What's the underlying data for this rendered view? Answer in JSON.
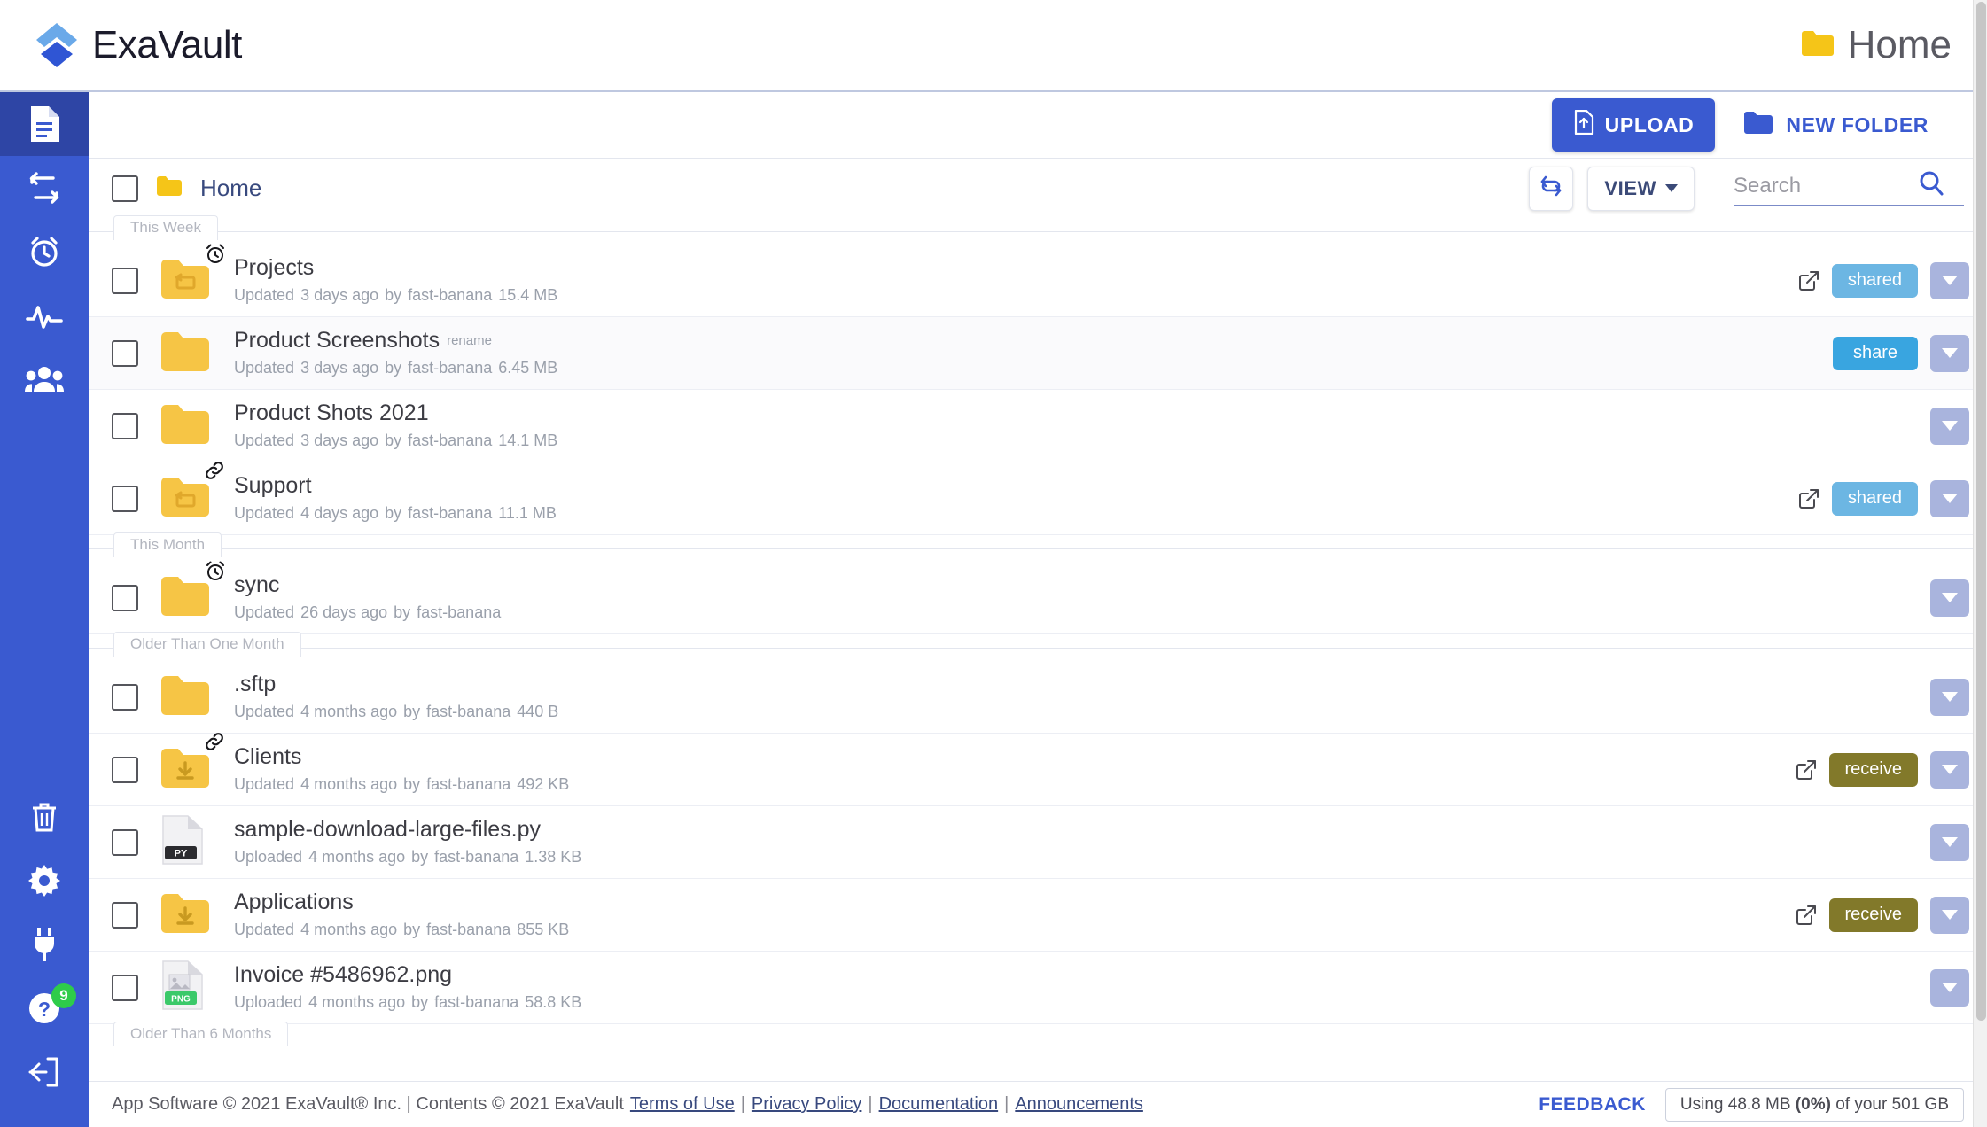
{
  "brand": {
    "name": "ExaVault",
    "logo_icon": "exavault-chevron-logo"
  },
  "header": {
    "location_title": "Home",
    "location_icon": "folder-icon"
  },
  "sidebar": {
    "top_items": [
      {
        "icon": "file-document-icon",
        "name": "files",
        "active": true
      },
      {
        "icon": "share-transfer-icon",
        "name": "transfers",
        "active": false
      },
      {
        "icon": "alarm-clock-icon",
        "name": "notifications",
        "active": false
      },
      {
        "icon": "activity-pulse-icon",
        "name": "activity",
        "active": false
      },
      {
        "icon": "users-group-icon",
        "name": "users",
        "active": false
      }
    ],
    "bottom_items": [
      {
        "icon": "trash-icon",
        "name": "trash",
        "badge": ""
      },
      {
        "icon": "gear-icon",
        "name": "settings",
        "badge": ""
      },
      {
        "icon": "plug-icon",
        "name": "integrations",
        "badge": ""
      },
      {
        "icon": "help-question-icon",
        "name": "help",
        "badge": "9"
      },
      {
        "icon": "logout-icon",
        "name": "logout",
        "badge": ""
      }
    ]
  },
  "toolbar": {
    "upload_label": "UPLOAD",
    "upload_icon": "upload-file-icon",
    "new_folder_label": "NEW FOLDER",
    "new_folder_icon": "folder-icon"
  },
  "crumbbar": {
    "select_all_checked": false,
    "breadcrumb": "Home",
    "breadcrumb_icon": "folder-icon",
    "refresh_icon": "refresh-icon",
    "view_label": "VIEW",
    "search": {
      "value": "",
      "placeholder": "Search",
      "icon": "search-icon"
    }
  },
  "list": {
    "sections": [
      {
        "label": "This Week",
        "rows": [
          {
            "name": "Projects",
            "rename_hint": "",
            "icon": "folder-shared-icon",
            "badge_icon": "alarm-clock-icon",
            "meta_action": "Updated",
            "meta_time": "3 days ago",
            "meta_by": "by",
            "meta_user": "fast-banana",
            "meta_size": "15.4 MB",
            "ext_link": true,
            "pill": "shared",
            "pill_type": "shared",
            "alt": false
          },
          {
            "name": "Product Screenshots",
            "rename_hint": "rename",
            "icon": "folder-icon",
            "badge_icon": "",
            "meta_action": "Updated",
            "meta_time": "3 days ago",
            "meta_by": "by",
            "meta_user": "fast-banana",
            "meta_size": "6.45 MB",
            "ext_link": false,
            "pill": "share",
            "pill_type": "share",
            "alt": true
          },
          {
            "name": "Product Shots 2021",
            "rename_hint": "",
            "icon": "folder-icon",
            "badge_icon": "",
            "meta_action": "Updated",
            "meta_time": "3 days ago",
            "meta_by": "by",
            "meta_user": "fast-banana",
            "meta_size": "14.1 MB",
            "ext_link": false,
            "pill": "",
            "pill_type": "",
            "alt": false
          },
          {
            "name": "Support",
            "rename_hint": "",
            "icon": "folder-shared-icon",
            "badge_icon": "link-icon",
            "meta_action": "Updated",
            "meta_time": "4 days ago",
            "meta_by": "by",
            "meta_user": "fast-banana",
            "meta_size": "11.1 MB",
            "ext_link": true,
            "pill": "shared",
            "pill_type": "shared",
            "alt": false
          }
        ]
      },
      {
        "label": "This Month",
        "rows": [
          {
            "name": "sync",
            "rename_hint": "",
            "icon": "folder-icon",
            "badge_icon": "alarm-clock-icon",
            "meta_action": "Updated",
            "meta_time": "26 days ago",
            "meta_by": "by",
            "meta_user": "fast-banana",
            "meta_size": "",
            "ext_link": false,
            "pill": "",
            "pill_type": "",
            "alt": false
          }
        ]
      },
      {
        "label": "Older Than One Month",
        "rows": [
          {
            "name": ".sftp",
            "rename_hint": "",
            "icon": "folder-icon",
            "badge_icon": "",
            "meta_action": "Updated",
            "meta_time": "4 months ago",
            "meta_by": "by",
            "meta_user": "fast-banana",
            "meta_size": "440 B",
            "ext_link": false,
            "pill": "",
            "pill_type": "",
            "alt": false
          },
          {
            "name": "Clients",
            "rename_hint": "",
            "icon": "folder-receive-icon",
            "badge_icon": "link-icon",
            "meta_action": "Updated",
            "meta_time": "4 months ago",
            "meta_by": "by",
            "meta_user": "fast-banana",
            "meta_size": "492 KB",
            "ext_link": true,
            "pill": "receive",
            "pill_type": "receive",
            "alt": false
          },
          {
            "name": "sample-download-large-files.py",
            "rename_hint": "",
            "icon": "file-py-icon",
            "badge_icon": "",
            "meta_action": "Uploaded",
            "meta_time": "4 months ago",
            "meta_by": "by",
            "meta_user": "fast-banana",
            "meta_size": "1.38 KB",
            "ext_link": false,
            "pill": "",
            "pill_type": "",
            "alt": false
          },
          {
            "name": "Applications",
            "rename_hint": "",
            "icon": "folder-receive-icon",
            "badge_icon": "",
            "meta_action": "Updated",
            "meta_time": "4 months ago",
            "meta_by": "by",
            "meta_user": "fast-banana",
            "meta_size": "855 KB",
            "ext_link": true,
            "pill": "receive",
            "pill_type": "receive",
            "alt": false
          },
          {
            "name": "Invoice #5486962.png",
            "rename_hint": "",
            "icon": "file-png-icon",
            "badge_icon": "",
            "meta_action": "Uploaded",
            "meta_time": "4 months ago",
            "meta_by": "by",
            "meta_user": "fast-banana",
            "meta_size": "58.8 KB",
            "ext_link": false,
            "pill": "",
            "pill_type": "",
            "alt": false
          }
        ]
      },
      {
        "label": "Older Than 6 Months",
        "rows": []
      }
    ]
  },
  "footer": {
    "copy_1": "App Software © 2021 ExaVault® Inc. | Contents © 2021 ExaVault",
    "links": [
      "Terms of Use",
      "Privacy Policy",
      "Documentation",
      "Announcements"
    ],
    "feedback_label": "FEEDBACK",
    "quota_text": "Using 48.8 MB (0%) of your 501 GB",
    "quota_pre": "Using 48.8 MB ",
    "quota_pct": "(0%)",
    "quota_post": " of your 501 GB"
  },
  "colors": {
    "brand_blue": "#3a5ad0",
    "sidebar_blue": "#3a5ad0",
    "sidebar_active": "#2e45a5",
    "folder_yellow": "#f6c545",
    "shared_pill": "#6cb6e3",
    "share_pill": "#39a5e0",
    "receive_pill": "#82792a",
    "badge_green": "#2ecc4a"
  }
}
